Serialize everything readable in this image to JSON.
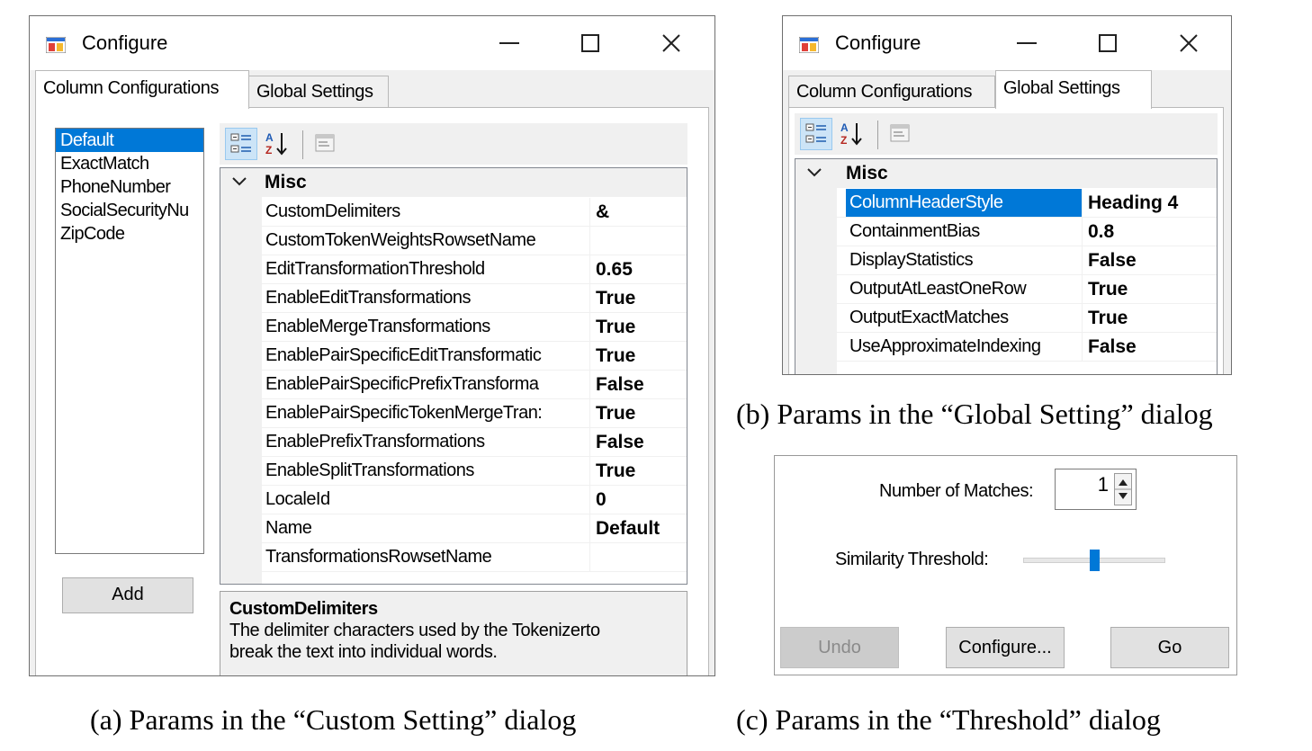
{
  "dialog_a": {
    "title": "Configure",
    "tabs": [
      {
        "label": "Column Configurations",
        "active": true
      },
      {
        "label": "Global Settings",
        "active": false
      }
    ],
    "list_items": [
      {
        "label": "Default",
        "selected": true
      },
      {
        "label": "ExactMatch",
        "selected": false
      },
      {
        "label": "PhoneNumber",
        "selected": false
      },
      {
        "label": "SocialSecurityNu",
        "selected": false
      },
      {
        "label": "ZipCode",
        "selected": false
      }
    ],
    "add_button": "Add",
    "property_grid": {
      "category": "Misc",
      "properties": [
        {
          "name": "CustomDelimiters",
          "value": "&"
        },
        {
          "name": "CustomTokenWeightsRowsetName",
          "value": ""
        },
        {
          "name": "EditTransformationThreshold",
          "value": "0.65"
        },
        {
          "name": "EnableEditTransformations",
          "value": "True"
        },
        {
          "name": "EnableMergeTransformations",
          "value": "True"
        },
        {
          "name": "EnablePairSpecificEditTransformatic",
          "value": "True"
        },
        {
          "name": "EnablePairSpecificPrefixTransforma",
          "value": "False"
        },
        {
          "name": "EnablePairSpecificTokenMergeTran:",
          "value": "True"
        },
        {
          "name": "EnablePrefixTransformations",
          "value": "False"
        },
        {
          "name": "EnableSplitTransformations",
          "value": "True"
        },
        {
          "name": "LocaleId",
          "value": "0"
        },
        {
          "name": "Name",
          "value": "Default"
        },
        {
          "name": "TransformationsRowsetName",
          "value": ""
        }
      ]
    },
    "help": {
      "title": "CustomDelimiters",
      "description_line1": "The delimiter characters used by the Tokenizerto",
      "description_line2": "break the text into individual words."
    }
  },
  "dialog_b": {
    "title": "Configure",
    "tabs": [
      {
        "label": "Column Configurations",
        "active": false
      },
      {
        "label": "Global Settings",
        "active": true
      }
    ],
    "property_grid": {
      "category": "Misc",
      "properties": [
        {
          "name": "ColumnHeaderStyle",
          "value": "Heading 4",
          "selected": true
        },
        {
          "name": "ContainmentBias",
          "value": "0.8",
          "selected": false
        },
        {
          "name": "DisplayStatistics",
          "value": "False",
          "selected": false
        },
        {
          "name": "OutputAtLeastOneRow",
          "value": "True",
          "selected": false
        },
        {
          "name": "OutputExactMatches",
          "value": "True",
          "selected": false
        },
        {
          "name": "UseApproximateIndexing",
          "value": "False",
          "selected": false
        }
      ]
    }
  },
  "panel_c": {
    "matches_label": "Number of Matches:",
    "matches_value": "1",
    "threshold_label": "Similarity Threshold:",
    "threshold_level_fraction": 0.5,
    "undo_button": "Undo",
    "configure_button": "Configure...",
    "go_button": "Go"
  },
  "captions": {
    "a": "(a)  Params in the “Custom Setting” dialog",
    "b": "(b) Params in the “Global Setting” dialog",
    "c": "(c) Params in the “Threshold” dialog"
  },
  "colors": {
    "selection": "#0078d7",
    "window_bg": "#f0f0f0"
  },
  "icons": [
    "app-icon",
    "minimize-icon",
    "maximize-icon",
    "close-icon",
    "categorized-icon",
    "alphabetical-icon",
    "property-pages-icon",
    "chevron-down-icon",
    "spin-arrows-icon",
    "slider-thumb"
  ]
}
